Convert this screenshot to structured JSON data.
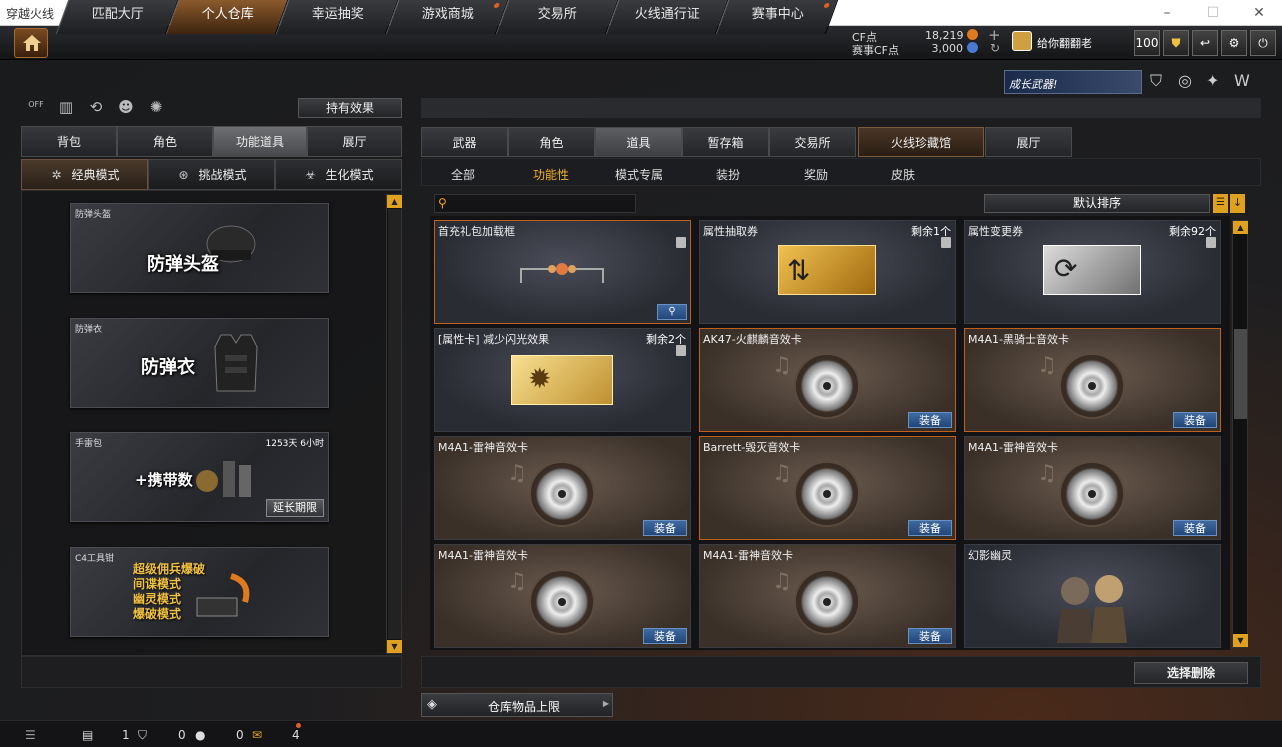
{
  "window": {
    "title": "穿越火线",
    "minimize": "–",
    "maximize": "☐",
    "close": "✕"
  },
  "nav": {
    "tabs": [
      {
        "label": "匹配大厅"
      },
      {
        "label": "个人仓库"
      },
      {
        "label": "幸运抽奖"
      },
      {
        "label": "游戏商城"
      },
      {
        "label": "交易所"
      },
      {
        "label": "火线通行证"
      },
      {
        "label": "赛事中心"
      }
    ],
    "cf_label": "CF点",
    "cf_value": "18,219",
    "match_cf_label": "赛事CF点",
    "match_cf_value": "3,000",
    "plus": "+",
    "user_name": "给你翻翻老",
    "level": "100"
  },
  "promo": {
    "text": "成长武器!"
  },
  "left": {
    "effect_button": "持有效果",
    "toggle_off": "OFF",
    "tabs": [
      "背包",
      "角色",
      "功能道具",
      "展厅"
    ],
    "modes": [
      "经典模式",
      "挑战模式",
      "生化模式"
    ],
    "cards": [
      {
        "name": "防弹头盔",
        "big": "防弹头盔"
      },
      {
        "name": "防弹衣",
        "big": "防弹衣"
      },
      {
        "name": "手雷包",
        "big": "+携带数",
        "extra": "1253天 6小时",
        "action": "延长期限"
      },
      {
        "name": "C4工具钳",
        "lines": [
          "超级佣兵爆破",
          "间谍模式",
          "幽灵模式",
          "爆破模式"
        ]
      }
    ]
  },
  "right": {
    "tabs": [
      "武器",
      "角色",
      "道具",
      "暂存箱",
      "交易所",
      "火线珍藏馆",
      "展厅"
    ],
    "subtabs": [
      "全部",
      "功能性",
      "模式专属",
      "装扮",
      "奖励",
      "皮肤"
    ],
    "sort_label": "默认排序",
    "equip": "装备",
    "items": [
      {
        "name": "首充礼包加载框",
        "count": ""
      },
      {
        "name": "属性抽取券",
        "count": "剩余1个"
      },
      {
        "name": "属性变更券",
        "count": "剩余92个"
      },
      {
        "name": "[属性卡] 减少闪光效果",
        "count": "剩余2个"
      },
      {
        "name": "AK47-火麒麟音效卡",
        "count": ""
      },
      {
        "name": "M4A1-黑骑士音效卡",
        "count": ""
      },
      {
        "name": "M4A1-雷神音效卡",
        "count": ""
      },
      {
        "name": "Barrett-毁灭音效卡",
        "count": ""
      },
      {
        "name": "M4A1-雷神音效卡",
        "count": ""
      },
      {
        "name": "M4A1-雷神音效卡",
        "count": ""
      },
      {
        "name": "M4A1-雷神音效卡",
        "count": ""
      },
      {
        "name": "幻影幽灵",
        "count": ""
      }
    ],
    "delete_button": "选择删除",
    "capacity_label": "仓库物品上限"
  },
  "bottom": {
    "v1": "1",
    "v2": "0",
    "v3": "0",
    "v4": "4"
  }
}
